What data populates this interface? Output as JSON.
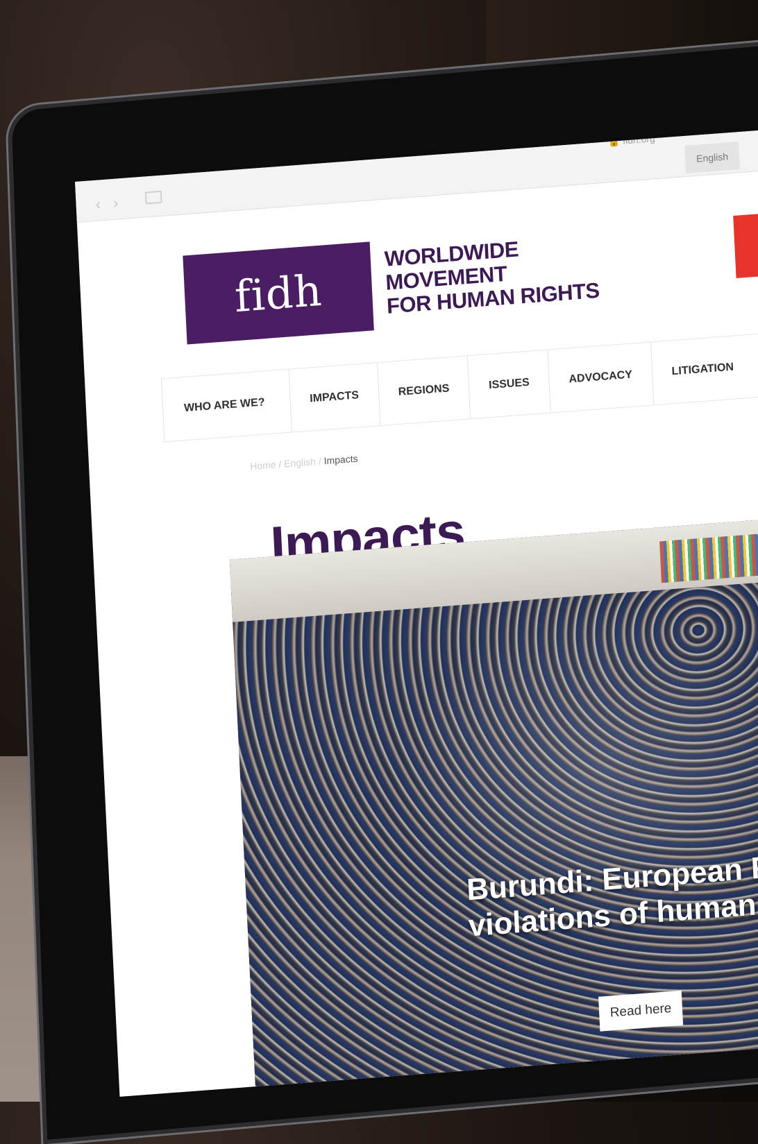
{
  "browser": {
    "url": "fidh.org",
    "language_button": "English"
  },
  "site": {
    "logo_text": "fidh",
    "tagline_line1": "WORLDWIDE MOVEMENT",
    "tagline_line2": "FOR HUMAN RIGHTS",
    "brand_color": "#4b1d63",
    "accent_color": "#e8332b"
  },
  "menu": {
    "items": [
      {
        "label": "WHO ARE WE?"
      },
      {
        "label": "IMPACTS"
      },
      {
        "label": "REGIONS"
      },
      {
        "label": "ISSUES"
      },
      {
        "label": "ADVOCACY"
      },
      {
        "label": "LITIGATION"
      }
    ]
  },
  "breadcrumb": {
    "home": "Home",
    "sep1": " / ",
    "lang": "English",
    "sep2": " / ",
    "current": "Impacts"
  },
  "page": {
    "title": "Impacts"
  },
  "hero": {
    "caption_line1": "Burundi: European Pa",
    "caption_line2": "violations of human r",
    "read_more": "Read here"
  }
}
